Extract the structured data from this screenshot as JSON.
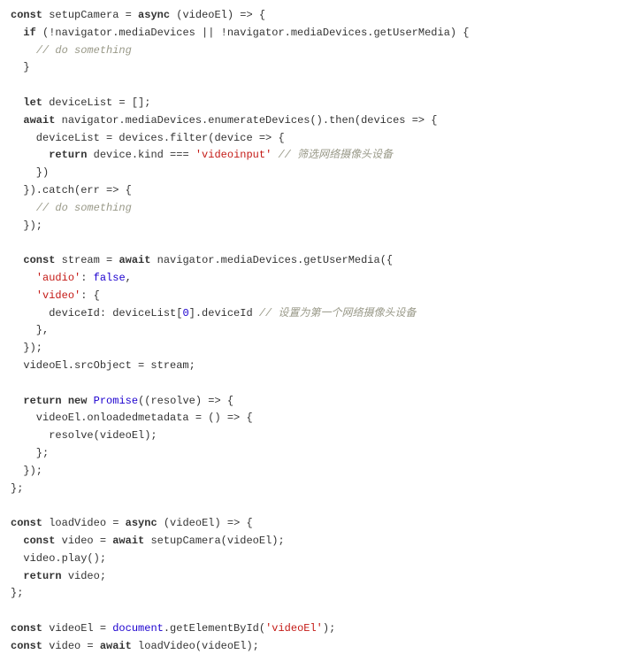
{
  "code": {
    "lines": [
      {
        "segments": [
          {
            "t": "const",
            "c": "kw"
          },
          {
            "t": " setupCamera = "
          },
          {
            "t": "async",
            "c": "kw"
          },
          {
            "t": " (videoEl) => {"
          }
        ]
      },
      {
        "segments": [
          {
            "t": "  "
          },
          {
            "t": "if",
            "c": "kw"
          },
          {
            "t": " (!navigator.mediaDevices || !navigator.mediaDevices.getUserMedia) {"
          }
        ]
      },
      {
        "segments": [
          {
            "t": "    "
          },
          {
            "t": "// do something",
            "c": "com"
          }
        ]
      },
      {
        "segments": [
          {
            "t": "  }"
          }
        ]
      },
      {
        "segments": [
          {
            "t": ""
          }
        ]
      },
      {
        "segments": [
          {
            "t": "  "
          },
          {
            "t": "let",
            "c": "kw"
          },
          {
            "t": " deviceList = [];"
          }
        ]
      },
      {
        "segments": [
          {
            "t": "  "
          },
          {
            "t": "await",
            "c": "kw"
          },
          {
            "t": " navigator.mediaDevices.enumerateDevices().then(devices => {"
          }
        ]
      },
      {
        "segments": [
          {
            "t": "    deviceList = devices.filter(device => {"
          }
        ]
      },
      {
        "segments": [
          {
            "t": "      "
          },
          {
            "t": "return",
            "c": "kw"
          },
          {
            "t": " device.kind === "
          },
          {
            "t": "'videoinput'",
            "c": "str"
          },
          {
            "t": " "
          },
          {
            "t": "// 筛选网络摄像头设备",
            "c": "com"
          }
        ]
      },
      {
        "segments": [
          {
            "t": "    })"
          }
        ]
      },
      {
        "segments": [
          {
            "t": "  }).catch(err => {"
          }
        ]
      },
      {
        "segments": [
          {
            "t": "    "
          },
          {
            "t": "// do something",
            "c": "com"
          }
        ]
      },
      {
        "segments": [
          {
            "t": "  });"
          }
        ]
      },
      {
        "segments": [
          {
            "t": ""
          }
        ]
      },
      {
        "segments": [
          {
            "t": "  "
          },
          {
            "t": "const",
            "c": "kw"
          },
          {
            "t": " stream = "
          },
          {
            "t": "await",
            "c": "kw"
          },
          {
            "t": " navigator.mediaDevices.getUserMedia({"
          }
        ]
      },
      {
        "segments": [
          {
            "t": "    "
          },
          {
            "t": "'audio'",
            "c": "str"
          },
          {
            "t": ": "
          },
          {
            "t": "false",
            "c": "lit"
          },
          {
            "t": ","
          }
        ]
      },
      {
        "segments": [
          {
            "t": "    "
          },
          {
            "t": "'video'",
            "c": "str"
          },
          {
            "t": ": {"
          }
        ]
      },
      {
        "segments": [
          {
            "t": "      deviceId: deviceList["
          },
          {
            "t": "0",
            "c": "num"
          },
          {
            "t": "].deviceId "
          },
          {
            "t": "// 设置为第一个网络摄像头设备",
            "c": "com"
          }
        ]
      },
      {
        "segments": [
          {
            "t": "    },"
          }
        ]
      },
      {
        "segments": [
          {
            "t": "  });"
          }
        ]
      },
      {
        "segments": [
          {
            "t": "  videoEl.srcObject = stream;"
          }
        ]
      },
      {
        "segments": [
          {
            "t": ""
          }
        ]
      },
      {
        "segments": [
          {
            "t": "  "
          },
          {
            "t": "return",
            "c": "kw"
          },
          {
            "t": " "
          },
          {
            "t": "new",
            "c": "kw"
          },
          {
            "t": " "
          },
          {
            "t": "Promise",
            "c": "obj"
          },
          {
            "t": "((resolve) => {"
          }
        ]
      },
      {
        "segments": [
          {
            "t": "    videoEl.onloadedmetadata = () => {"
          }
        ]
      },
      {
        "segments": [
          {
            "t": "      resolve(videoEl);"
          }
        ]
      },
      {
        "segments": [
          {
            "t": "    };"
          }
        ]
      },
      {
        "segments": [
          {
            "t": "  });"
          }
        ]
      },
      {
        "segments": [
          {
            "t": "};"
          }
        ]
      },
      {
        "segments": [
          {
            "t": ""
          }
        ]
      },
      {
        "segments": [
          {
            "t": "const",
            "c": "kw"
          },
          {
            "t": " loadVideo = "
          },
          {
            "t": "async",
            "c": "kw"
          },
          {
            "t": " (videoEl) => {"
          }
        ]
      },
      {
        "segments": [
          {
            "t": "  "
          },
          {
            "t": "const",
            "c": "kw"
          },
          {
            "t": " video = "
          },
          {
            "t": "await",
            "c": "kw"
          },
          {
            "t": " setupCamera(videoEl);"
          }
        ]
      },
      {
        "segments": [
          {
            "t": "  video.play();"
          }
        ]
      },
      {
        "segments": [
          {
            "t": "  "
          },
          {
            "t": "return",
            "c": "kw"
          },
          {
            "t": " video;"
          }
        ]
      },
      {
        "segments": [
          {
            "t": "};"
          }
        ]
      },
      {
        "segments": [
          {
            "t": ""
          }
        ]
      },
      {
        "segments": [
          {
            "t": "const",
            "c": "kw"
          },
          {
            "t": " videoEl = "
          },
          {
            "t": "document",
            "c": "obj"
          },
          {
            "t": ".getElementById("
          },
          {
            "t": "'videoEl'",
            "c": "str"
          },
          {
            "t": ");"
          }
        ]
      },
      {
        "segments": [
          {
            "t": "const",
            "c": "kw"
          },
          {
            "t": " video = "
          },
          {
            "t": "await",
            "c": "kw"
          },
          {
            "t": " loadVideo(videoEl);"
          }
        ]
      }
    ]
  }
}
